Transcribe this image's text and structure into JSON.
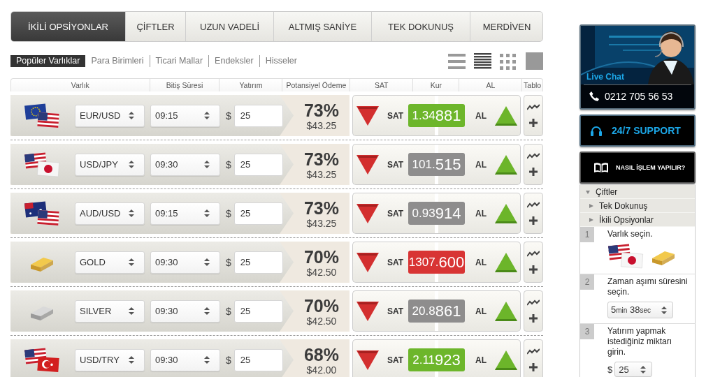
{
  "tabs": [
    {
      "label": "İKİLİ OPSİYONLAR",
      "selected": true
    },
    {
      "label": "ÇİFTLER",
      "selected": false
    },
    {
      "label": "UZUN VADELİ",
      "selected": false
    },
    {
      "label": "ALTMIŞ SANİYE",
      "selected": false
    },
    {
      "label": "TEK DOKUNUŞ",
      "selected": false
    },
    {
      "label": "MERDİVEN",
      "selected": false
    }
  ],
  "categories": [
    {
      "label": "Popüler Varlıklar",
      "selected": true
    },
    {
      "label": "Para Birimleri",
      "selected": false
    },
    {
      "label": "Ticari Mallar",
      "selected": false
    },
    {
      "label": "Endeksler",
      "selected": false
    },
    {
      "label": "Hisseler",
      "selected": false
    }
  ],
  "view_modes": [
    {
      "kind": "list",
      "selected": false
    },
    {
      "kind": "dense",
      "selected": true
    },
    {
      "kind": "grid",
      "selected": false
    },
    {
      "kind": "single",
      "selected": false
    }
  ],
  "table": {
    "columns": [
      "Varlık",
      "Bitiş Süresi",
      "Yatırım",
      "Potansiyel Ödeme",
      "SAT",
      "Kur",
      "AL",
      "Tablo"
    ],
    "rows": [
      {
        "kind": "eu-us",
        "asset": "EUR/USD",
        "expiry": "09:15",
        "currency": "$",
        "amount": "25",
        "percent": "73%",
        "payout": "$43.25",
        "sell_label": "SAT",
        "rate_prefix": "1.34",
        "rate_digits": "881",
        "color": "#6db62b",
        "buy_label": "AL"
      },
      {
        "kind": "us-jp",
        "asset": "USD/JPY",
        "expiry": "09:30",
        "currency": "$",
        "amount": "25",
        "percent": "73%",
        "payout": "$43.25",
        "sell_label": "SAT",
        "rate_prefix": "101.",
        "rate_digits": "515",
        "color": "#8e8d8d",
        "buy_label": "AL"
      },
      {
        "kind": "au-us",
        "asset": "AUD/USD",
        "expiry": "09:15",
        "currency": "$",
        "amount": "25",
        "percent": "73%",
        "payout": "$43.25",
        "sell_label": "SAT",
        "rate_prefix": "0.93",
        "rate_digits": "914",
        "color": "#8e8d8d",
        "buy_label": "AL"
      },
      {
        "kind": "gold",
        "asset": "GOLD",
        "expiry": "09:30",
        "currency": "$",
        "amount": "25",
        "percent": "70%",
        "payout": "$42.50",
        "sell_label": "SAT",
        "rate_prefix": "1307.",
        "rate_digits": "600",
        "color": "#d83434",
        "buy_label": "AL"
      },
      {
        "kind": "silver",
        "asset": "SILVER",
        "expiry": "09:30",
        "currency": "$",
        "amount": "25",
        "percent": "70%",
        "payout": "$42.50",
        "sell_label": "SAT",
        "rate_prefix": "20.8",
        "rate_digits": "861",
        "color": "#8e8d8d",
        "buy_label": "AL"
      },
      {
        "kind": "us-tr",
        "asset": "USD/TRY",
        "expiry": "09:30",
        "currency": "$",
        "amount": "25",
        "percent": "68%",
        "payout": "$42.00",
        "sell_label": "SAT",
        "rate_prefix": "2.11",
        "rate_digits": "923",
        "color": "#6db62b",
        "buy_label": "AL"
      }
    ]
  },
  "sidebar": {
    "live_chat": {
      "title": "Live Chat",
      "phone": "0212 705 56 53"
    },
    "support": {
      "label": "24/7 SUPPORT"
    },
    "how_to": {
      "label": "NASIL İŞLEM YAPILIR?"
    },
    "menu": [
      {
        "label": "Çiftler",
        "expanded": true
      },
      {
        "label": "Tek Dokunuş",
        "expanded": false
      },
      {
        "label": "İkili Opsiyonlar",
        "expanded": false
      }
    ],
    "steps": [
      {
        "number": "1",
        "text": "Varlık seçin.",
        "kind": "icons",
        "icons": [
          {
            "kind": "us-jp"
          },
          {
            "kind": "gold"
          }
        ]
      },
      {
        "number": "2",
        "text": "Zaman aşımı süresini seçin.",
        "kind": "timer",
        "minutes": "5",
        "min_unit": "min",
        "seconds": "38",
        "sec_unit": "sec"
      },
      {
        "number": "3",
        "text": "Yatırım yapmak istediğiniz miktarı girin.",
        "kind": "amount",
        "currency": "$",
        "value": "25"
      }
    ]
  }
}
